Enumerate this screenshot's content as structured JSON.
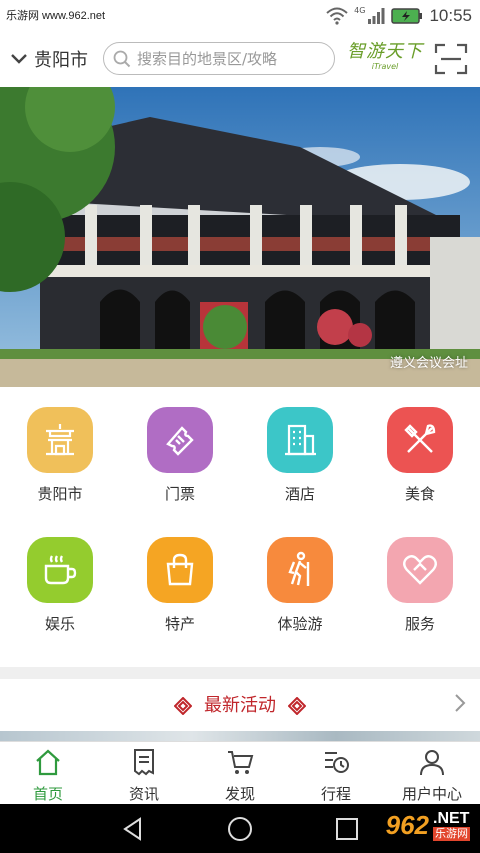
{
  "status_bar": {
    "watermark": "乐游网 www.962.net",
    "network": "4G",
    "time": "10:55"
  },
  "header": {
    "city": "贵阳市",
    "search_placeholder": "搜索目的地景区/攻略",
    "logo_cn": "智游天下",
    "logo_en": "iTravel"
  },
  "banner": {
    "caption": "遵义会议会址"
  },
  "categories": [
    {
      "label": "贵阳市",
      "icon": "city-gate-icon",
      "color": "#f0c05a"
    },
    {
      "label": "门票",
      "icon": "ticket-icon",
      "color": "#b06dc4"
    },
    {
      "label": "酒店",
      "icon": "hotel-building-icon",
      "color": "#3cc6c8"
    },
    {
      "label": "美食",
      "icon": "fork-knife-icon",
      "color": "#ec5352"
    },
    {
      "label": "娱乐",
      "icon": "coffee-cup-icon",
      "color": "#94cc2e"
    },
    {
      "label": "特产",
      "icon": "shopping-bag-icon",
      "color": "#f5a523"
    },
    {
      "label": "体验游",
      "icon": "hiker-icon",
      "color": "#f78a3d"
    },
    {
      "label": "服务",
      "icon": "heart-icon",
      "color": "#f3a6b0"
    }
  ],
  "activity": {
    "title": "最新活动"
  },
  "tabs": [
    {
      "label": "首页",
      "icon": "home-icon",
      "active": true
    },
    {
      "label": "资讯",
      "icon": "news-icon",
      "active": false
    },
    {
      "label": "发现",
      "icon": "cart-icon",
      "active": false
    },
    {
      "label": "行程",
      "icon": "itinerary-icon",
      "active": false
    },
    {
      "label": "用户中心",
      "icon": "user-icon",
      "active": false
    }
  ],
  "watermark_bottom": {
    "number": "962",
    "suffix": ".NET",
    "sub": "乐游网"
  },
  "colors": {
    "accent": "#2f9a3e",
    "activity": "#c0262b"
  }
}
